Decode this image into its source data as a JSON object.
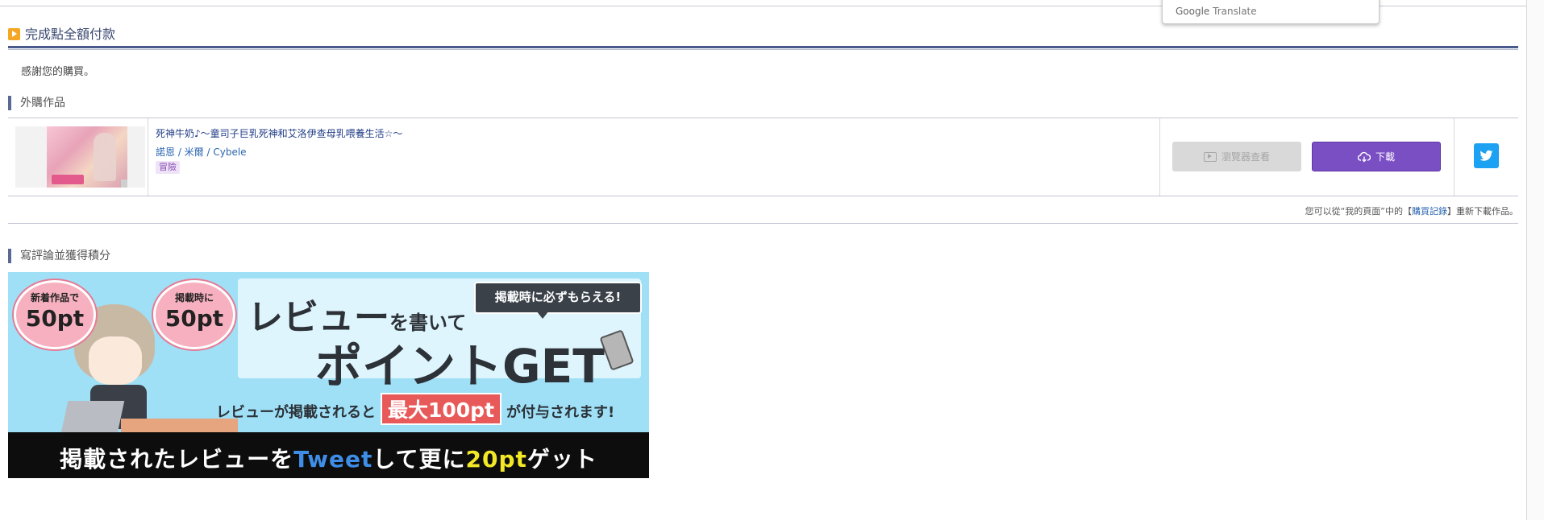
{
  "translate_popup": {
    "brand": "Google",
    "label": "Translate"
  },
  "page": {
    "complete_title": "完成點全額付款",
    "thanks": "感謝您的購買。"
  },
  "purchased_section": {
    "title": "外購作品",
    "work": {
      "title": "死神牛奶♪～童司子巨乳死神和艾洛伊查母乳喂養生活☆～",
      "meta": "諾恩 / 米爾 / Cybele",
      "genre": "冒險"
    },
    "preview_button": "瀏覽器查看",
    "download_button": "下載",
    "twitter_icon": "twitter-icon"
  },
  "redownload_note": {
    "prefix": "您可以從“我的頁面”中的【",
    "link": "購買記錄",
    "suffix": "】重新下載作品。"
  },
  "review_section": {
    "title": "寫評論並獲得積分",
    "banner": {
      "bubble_left_small": "新着作品で",
      "bubble_left_big": "50pt",
      "bubble_right_small": "掲載時に",
      "bubble_right_big": "50pt",
      "callout": "掲載時に必ずもらえる!",
      "headline_1a": "レビュー",
      "headline_1b": "を書いて",
      "headline_2": "ポイントGET",
      "max_prefix": "レビューが掲載されると",
      "max_highlight": "最大100pt",
      "max_suffix": "が付与されます!",
      "tweet_prefix": "掲載されたレビューを",
      "tweet_word": "Tweet",
      "tweet_mid": "して更に",
      "tweet_pt": "20pt",
      "tweet_suffix": "ゲット"
    }
  },
  "colors": {
    "accent_navy": "#4a5a8c",
    "download_purple": "#7b4fc4",
    "twitter_blue": "#1da1f2",
    "banner_blue": "#9fe0f7"
  }
}
